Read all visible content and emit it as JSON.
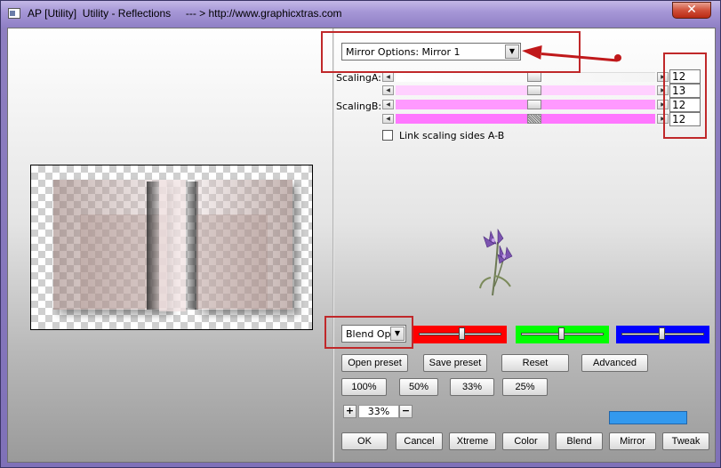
{
  "window": {
    "title": "AP [Utility]  Utility - Reflections     --- > http://www.graphicxtras.com",
    "close_label": "✕"
  },
  "mirror_select": {
    "value": "Mirror Options: Mirror 1"
  },
  "labels": {
    "scalingA": "ScalingA:",
    "scalingB": "ScalingB:",
    "link_scaling": "Link scaling sides A-B"
  },
  "sliders": [
    {
      "name": "scalingA-1",
      "value": "12",
      "level": 0.5
    },
    {
      "name": "scalingA-2",
      "value": "13",
      "level": 0.5
    },
    {
      "name": "scalingB-1",
      "value": "12",
      "level": 0.5
    },
    {
      "name": "scalingB-2",
      "value": "12",
      "level": 0.5
    }
  ],
  "blend_select": {
    "value": "Blend Optio"
  },
  "color_sliders": [
    {
      "name": "red",
      "color": "#ff0000",
      "level": 0.52
    },
    {
      "name": "green",
      "color": "#00ff00",
      "level": 0.5
    },
    {
      "name": "blue",
      "color": "#0000ff",
      "level": 0.5
    }
  ],
  "buttons": {
    "open_preset": "Open preset",
    "save_preset": "Save preset",
    "reset": "Reset",
    "advanced": "Advanced",
    "zoom100": "100%",
    "zoom50": "50%",
    "zoom33": "33%",
    "zoom25": "25%",
    "ok": "OK",
    "cancel": "Cancel",
    "xtreme": "Xtreme",
    "color": "Color",
    "blend": "Blend",
    "mirror": "Mirror",
    "tweak": "Tweak"
  },
  "zoom_stepper": {
    "plus": "+",
    "value": "33%",
    "minus": "−"
  },
  "colors": {
    "accent_red": "#c0282a",
    "preview_swatch": "#3399ee",
    "slider_pink_light": "#ffccff",
    "slider_pink": "#ff88ff"
  }
}
